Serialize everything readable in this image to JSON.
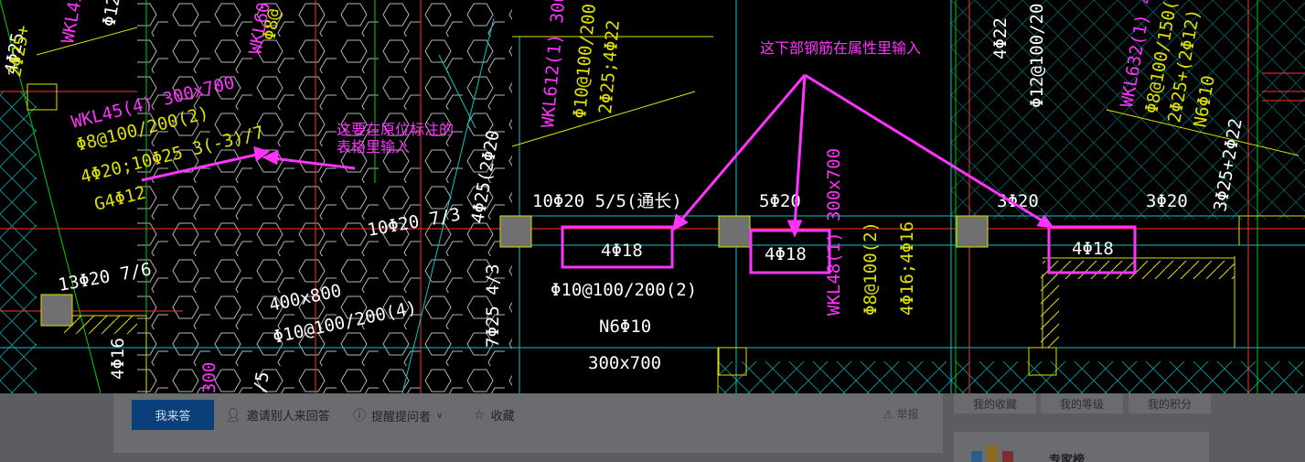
{
  "cad": {
    "annotations": {
      "top_note": "这下部钢筋在属性里输入",
      "left_note_line1": "这要在原位标注的",
      "left_note_line2": "表格里输入"
    },
    "boxed_labels": [
      "4Φ18",
      "4Φ18",
      "4Φ18"
    ],
    "texts": {
      "wkl45_name": "WKL45(4) 300x700",
      "wkl45_stirrup": "Φ8@100/200(2)",
      "wkl45_bars": "4Φ20;10Φ25 3(-3)/7",
      "wkl45_g": "G4Φ12",
      "top_left_a": "2Φ25+",
      "top_left_b": "WKL45",
      "top_left_c": "Φ12",
      "top_left_d": "WKL60",
      "top_left_e": "Φ8@",
      "wkl612_name": "WKL612(1) 300",
      "wkl612_stirrup": "Φ10@100/200",
      "wkl612_bars": "2Φ25;4Φ22",
      "mid_col_a": "4Φ22",
      "mid_col_b": "Φ12@100/20",
      "right_a": "WKL632(1) 4",
      "right_b": "Φ8@100/150(4",
      "right_c": "2Φ25+(2Φ12)",
      "right_d": "N6Φ10",
      "right_e": "3Φ25+2Φ22",
      "right_f": "4Φ25",
      "top_span_1": "10Φ20 5/5(通长)",
      "top_span_2": "5Φ20",
      "top_span_3": "3Φ20",
      "top_span_4": "3Φ20",
      "left_span": "10Φ20 7/3",
      "left_span_vert": "4Φ25(2Φ20",
      "beam_stirrup": "Φ10@100/200(2)",
      "beam_n": "N6Φ10",
      "beam_size": "300x700",
      "sec_400": "400x800",
      "sec_400_stirrup": "Φ10@100/200(4)",
      "left_13": "13Φ20 7/6",
      "left_4phi16": "4Φ16",
      "v_725": "7Φ25 4/3",
      "wkl48_name": "WKL48(1) 300x700",
      "wkl48_stirrup": "Φ8@100(2)",
      "wkl48_bars": "4Φ16;4Φ16",
      "bottom_left_num": "300",
      "bottom_left_num2": "/5"
    },
    "colors": {
      "magenta": "#ff33ff",
      "yellow": "#e0e000",
      "white": "#ffffff",
      "red": "#ff3030",
      "cyan": "#00c8c8",
      "green": "#00d000"
    }
  },
  "toolbar": {
    "answer_label": "我来答",
    "invite_label": "邀请别人来回答",
    "remind_label": "提醒提问者",
    "favorite_label": "收藏",
    "report_label": "举报",
    "icons": {
      "invite": "person-icon",
      "remind": "info-icon",
      "favorite": "star-icon",
      "report": "warning-icon"
    }
  },
  "sidebar": {
    "buttons": [
      "我的收藏",
      "我的等级",
      "我的积分"
    ],
    "expert_title": "专家榜"
  }
}
